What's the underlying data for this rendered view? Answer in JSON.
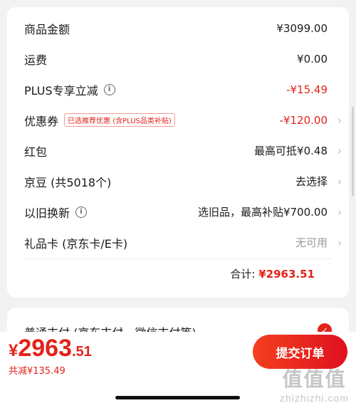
{
  "summary": {
    "goods_amount": {
      "label": "商品金额",
      "value": "¥3099.00"
    },
    "shipping": {
      "label": "运费",
      "value": "¥0.00"
    },
    "plus_discount": {
      "label": "PLUS专享立减",
      "value": "-¥15.49"
    },
    "coupon": {
      "label": "优惠券",
      "badge": "已选推荐优惠 (含PLUS品类补贴)",
      "value": "-¥120.00"
    },
    "red_packet": {
      "label": "红包",
      "value": "最高可抵¥0.48"
    },
    "jingdou": {
      "label": "京豆 (共5018个)",
      "value": "去选择"
    },
    "trade_in": {
      "label": "以旧换新",
      "value": "选旧品，最高补贴¥700.00"
    },
    "gift_card": {
      "label": "礼品卡 (京东卡/E卡)",
      "value": "无可用"
    },
    "total": {
      "label": "合计:",
      "value": "¥2963.51"
    }
  },
  "payment": {
    "title": "普通支付 (京东支付、微信支付等)"
  },
  "bottom_bar": {
    "currency": "¥",
    "price_int": "2963",
    "price_dec": ".51",
    "saved": "共减¥135.49",
    "submit_label": "提交订单"
  },
  "watermark": {
    "logo": "值值值",
    "url": "zhizhizhi.com"
  },
  "icons": {
    "chevron": "chevron-right-icon",
    "info": "info-icon",
    "check": "check-icon"
  },
  "colors": {
    "accent": "#e2231a",
    "background": "#f2f2f2"
  }
}
